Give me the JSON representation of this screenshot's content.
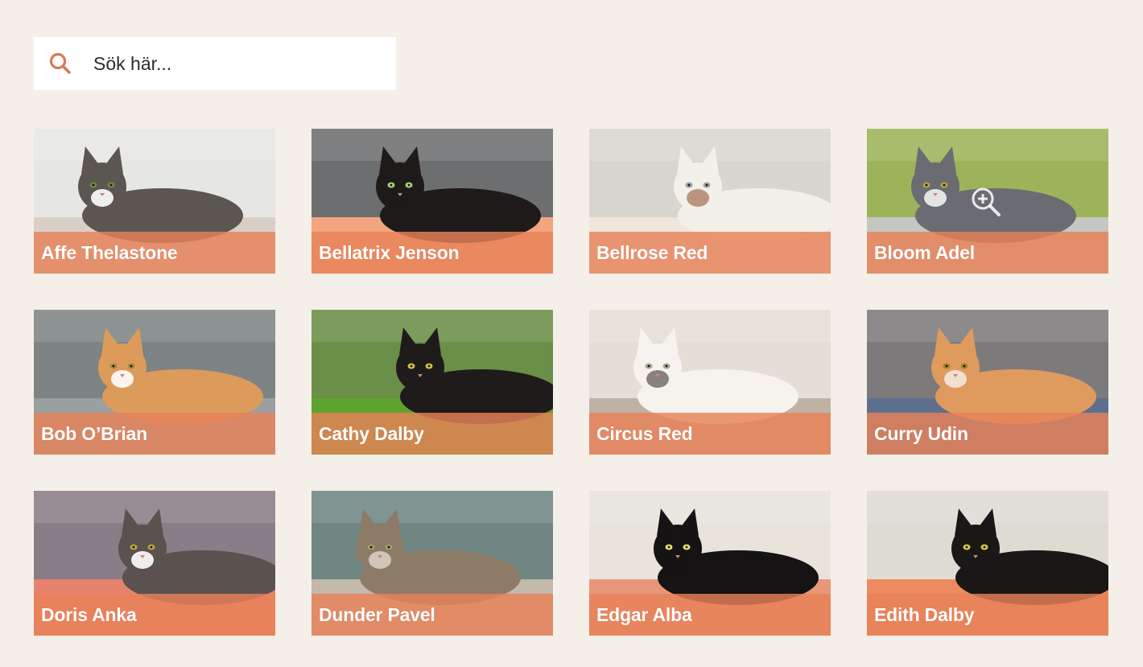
{
  "search": {
    "placeholder": "Sök här...",
    "value": "",
    "icon": "search-icon",
    "accent": "#d97b53"
  },
  "label_color": "#e8815a",
  "cats": [
    {
      "name": "Affe Thelastone",
      "bg": "#e6e6e2",
      "floor": "#d9cfc7",
      "cat": "#5b5651",
      "accent": "#ffffff",
      "eyes": "#6f8a3a"
    },
    {
      "name": "Bellatrix Jenson",
      "bg": "#6d6e70",
      "floor": "#f2a57f",
      "cat": "#1d1a19",
      "accent": "#1d1a19",
      "eyes": "#a8d07c"
    },
    {
      "name": "Bellrose Red",
      "bg": "#d9d6d0",
      "floor": "#efe6dc",
      "cat": "#f3efe9",
      "accent": "#b48c72",
      "eyes": "#9aa3a7"
    },
    {
      "name": "Bloom Adel",
      "bg": "#9db35a",
      "floor": "#c5c7c2",
      "cat": "#6b6c72",
      "accent": "#f2f2f2",
      "eyes": "#b8a23b"
    },
    {
      "name": "Bob O’Brian",
      "bg": "#7e8383",
      "floor": "#9aa0a0",
      "cat": "#dc9b5b",
      "accent": "#ffffff",
      "eyes": "#a08c45"
    },
    {
      "name": "Cathy Dalby",
      "bg": "#6a8f48",
      "floor": "#5ea32f",
      "cat": "#1f1b1a",
      "accent": "#1f1b1a",
      "eyes": "#d1c04a"
    },
    {
      "name": "Circus Red",
      "bg": "#e5ded6",
      "floor": "#bfb2a2",
      "cat": "#f6f3ef",
      "accent": "#7c7470",
      "eyes": "#b0a38c"
    },
    {
      "name": "Curry Udin",
      "bg": "#7d7a7c",
      "floor": "#5d6f8f",
      "cat": "#df9a5e",
      "accent": "#f3e7dc",
      "eyes": "#a3852e"
    },
    {
      "name": "Doris Anka",
      "bg": "#8b7d87",
      "floor": "#e7836d",
      "cat": "#5b514e",
      "accent": "#ffffff",
      "eyes": "#b9a53c"
    },
    {
      "name": "Dunder Pavel",
      "bg": "#6f8683",
      "floor": "#c2b9ab",
      "cat": "#8c7b66",
      "accent": "#d7cfc2",
      "eyes": "#a39d63"
    },
    {
      "name": "Edgar Alba",
      "bg": "#e8e4dc",
      "floor": "#e9967a",
      "cat": "#151313",
      "accent": "#151313",
      "eyes": "#e5df6a"
    },
    {
      "name": "Edith Dalby",
      "bg": "#dedbd3",
      "floor": "#ec8b5f",
      "cat": "#1a1717",
      "accent": "#1a1717",
      "eyes": "#d6c947"
    }
  ]
}
